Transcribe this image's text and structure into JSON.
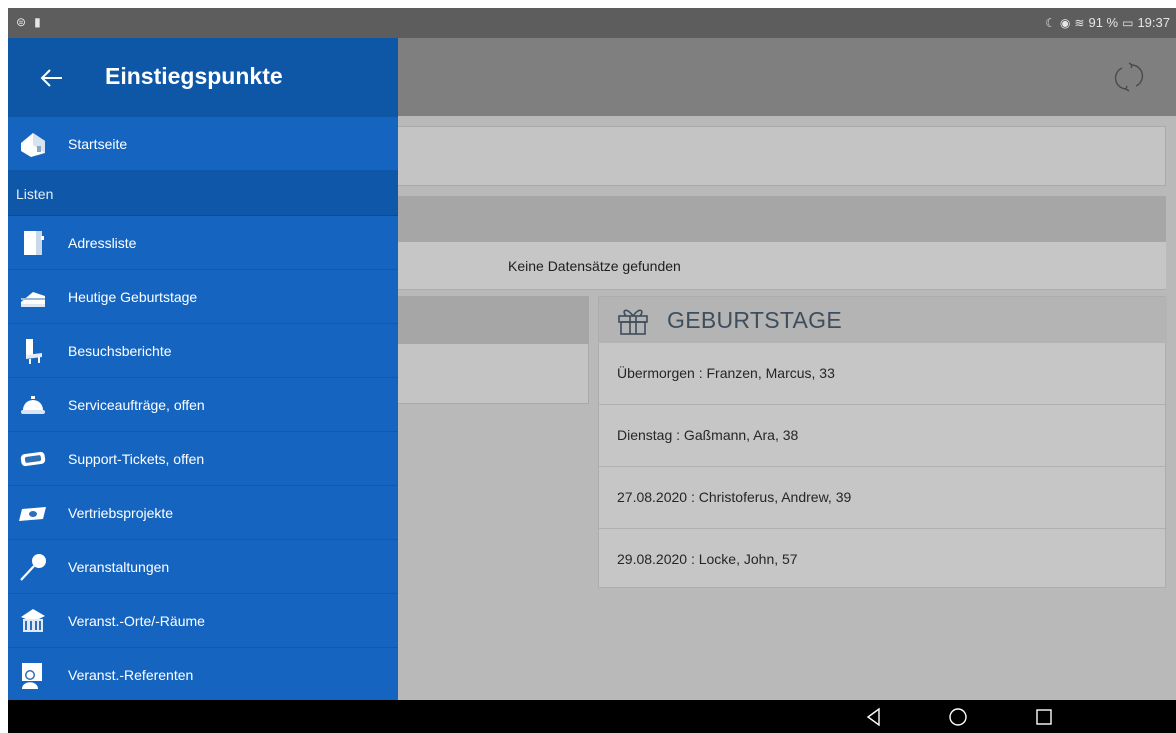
{
  "status_bar": {
    "battery_percent": "91 %",
    "time": "19:37"
  },
  "drawer": {
    "title": "Einstiegspunkte",
    "home_item": {
      "label": "Startseite",
      "icon": "house-icon"
    },
    "section_label": "Listen",
    "items": [
      {
        "label": "Adressliste",
        "icon": "address-book-icon"
      },
      {
        "label": "Heutige Geburtstage",
        "icon": "cake-icon"
      },
      {
        "label": "Besuchsberichte",
        "icon": "chair-icon"
      },
      {
        "label": "Serviceaufträge, offen",
        "icon": "service-bell-icon"
      },
      {
        "label": "Support-Tickets, offen",
        "icon": "ticket-icon"
      },
      {
        "label": "Vertriebsprojekte",
        "icon": "money-icon"
      },
      {
        "label": "Veranstaltungen",
        "icon": "microphone-icon"
      },
      {
        "label": "Veranst.-Orte/-Räume",
        "icon": "building-icon"
      },
      {
        "label": "Veranst.-Referenten",
        "icon": "speaker-person-icon"
      }
    ]
  },
  "content": {
    "empty_message": "Keine Datensätze gefunden",
    "birthdays": {
      "title": "GEBURTSTAGE",
      "entries": [
        "Übermorgen : Franzen, Marcus, 33",
        "Dienstag : Gaßmann, Ara, 38",
        "27.08.2020 : Christoferus, Andrew, 39",
        "29.08.2020 : Locke, John, 57"
      ]
    }
  },
  "colors": {
    "drawer_bg": "#1565c0",
    "drawer_header": "#0e56a6",
    "scrim_gray": "#b9b9b9"
  }
}
